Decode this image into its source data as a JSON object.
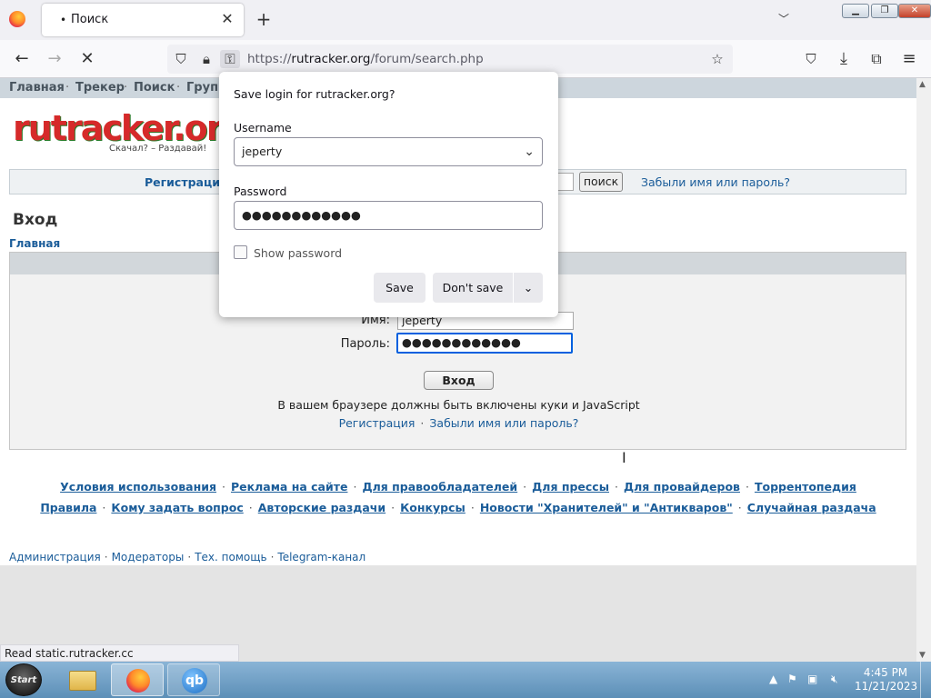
{
  "browser": {
    "tab_title": "Поиск",
    "tab_dot": "•",
    "url_domain": "rutracker.org",
    "url_prefix": "https://",
    "url_path": "/forum/search.php",
    "status_text": "Read static.rutracker.cc"
  },
  "site": {
    "top_menu": [
      "Главная",
      "Трекер",
      "Поиск",
      "Групп"
    ],
    "logo_text": "rutracker.org",
    "logo_slogan": "Скачал? – Раздавай!",
    "reg_link": "Регистрация",
    "search_button": "поиск",
    "forgot_link": "Забыли имя или пароль?",
    "page_heading": "Вход",
    "breadcrumb": "Главная",
    "login": {
      "name_label": "Имя:",
      "name_value": "jeperty",
      "password_label": "Пароль:",
      "password_value": "●●●●●●●●●●●●",
      "submit": "Вход",
      "cookie_notice": "В вашем браузере должны быть включены куки и JavaScript",
      "links": [
        "Регистрация",
        "Забыли имя или пароль?"
      ]
    },
    "footer_row1": [
      "Условия использования",
      "Реклама на сайте",
      "Для правообладателей",
      "Для прессы",
      "Для провайдеров",
      "Торрентопедия"
    ],
    "footer_row2": [
      "Правила",
      "Кому задать вопрос",
      "Авторские раздачи",
      "Конкурсы",
      "Новости \"Хранителей\" и \"Антикваров\"",
      "Случайная раздача"
    ],
    "admin_links": [
      "Администрация",
      "Модераторы",
      "Тех. помощь",
      "Telegram-канал"
    ]
  },
  "popup": {
    "title": "Save login for rutracker.org?",
    "username_label": "Username",
    "username_value": "jeperty",
    "password_label": "Password",
    "password_value": "●●●●●●●●●●●●",
    "show_password": "Show password",
    "save": "Save",
    "dont_save": "Don't save"
  },
  "taskbar": {
    "start": "Start",
    "qb": "qb",
    "time": "4:45 PM",
    "date": "11/21/2023"
  }
}
